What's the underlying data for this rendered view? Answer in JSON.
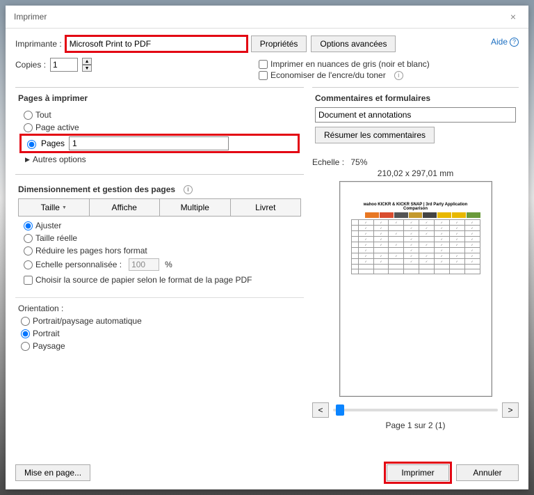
{
  "window": {
    "title": "Imprimer"
  },
  "top": {
    "printer_label": "Imprimante :",
    "printer_value": "Microsoft Print to PDF",
    "properties_btn": "Propriétés",
    "advanced_btn": "Options avancées",
    "help_text": "Aide",
    "copies_label": "Copies :",
    "copies_value": "1",
    "grayscale_label": "Imprimer en nuances de gris (noir et blanc)",
    "ink_label": "Economiser de l'encre/du toner"
  },
  "pages_section": {
    "title": "Pages à imprimer",
    "all": "Tout",
    "active": "Page active",
    "pages": "Pages",
    "pages_value": "1",
    "other": "Autres options"
  },
  "size_section": {
    "title": "Dimensionnement et gestion des pages",
    "tab_size": "Taille",
    "tab_poster": "Affiche",
    "tab_multi": "Multiple",
    "tab_booklet": "Livret",
    "fit": "Ajuster",
    "actual": "Taille réelle",
    "shrink": "Réduire les pages hors format",
    "custom": "Echelle personnalisée :",
    "custom_value": "100",
    "custom_pct": "%",
    "paper_source": "Choisir la source de papier selon le format de la page PDF"
  },
  "orient_section": {
    "title": "Orientation :",
    "auto": "Portrait/paysage automatique",
    "portrait": "Portrait",
    "landscape": "Paysage"
  },
  "comments_section": {
    "title": "Commentaires et formulaires",
    "value": "Document et annotations",
    "summarize": "Résumer les commentaires"
  },
  "preview": {
    "echelle_label": "Echelle :",
    "echelle_value": "75%",
    "dims": "210,02 x 297,01 mm",
    "doc_header": "wahoo KICKR & KICKR SNAP | 3rd Party Application Comparison",
    "prev": "<",
    "next": ">",
    "pageof": "Page 1 sur 2 (1)"
  },
  "footer": {
    "page_setup": "Mise en page...",
    "print": "Imprimer",
    "cancel": "Annuler"
  }
}
